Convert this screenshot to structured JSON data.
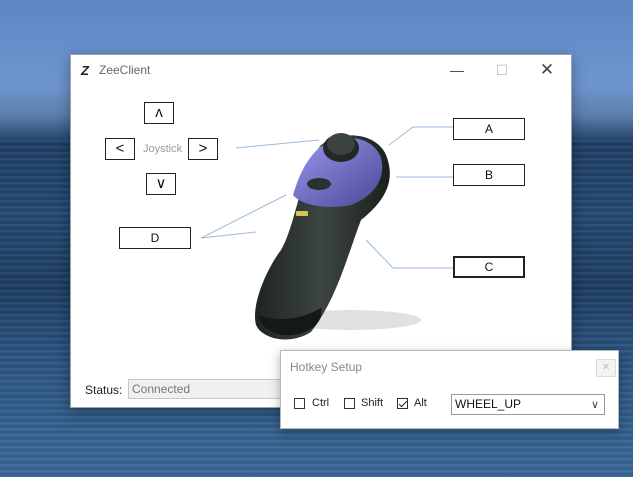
{
  "window": {
    "logo": "Z",
    "title": "ZeeClient",
    "minimize_icon": "minimize-icon",
    "maximize_icon": "maximize-icon",
    "close_icon": "close-icon"
  },
  "dpad": {
    "up": "ʌ",
    "left": "<",
    "right": ">",
    "down": "∨",
    "label": "Joystick"
  },
  "buttons": {
    "a": "A",
    "b": "B",
    "c": "C",
    "d": "D"
  },
  "status": {
    "label": "Status:",
    "value": "Connected"
  },
  "hotkey": {
    "title": "Hotkey Setup",
    "ctrl_label": "Ctrl",
    "ctrl_checked": false,
    "shift_label": "Shift",
    "shift_checked": false,
    "alt_label": "Alt",
    "alt_checked": true,
    "selected_key": "WHEEL_UP",
    "close_icon": "close-icon"
  },
  "colors": {
    "accent_purple": "#7d78d6",
    "controller_body": "#2c3330"
  }
}
